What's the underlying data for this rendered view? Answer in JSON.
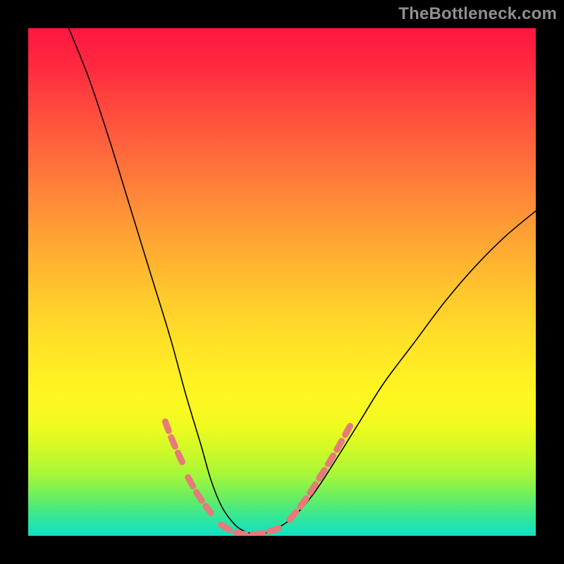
{
  "watermark": "TheBottleneck.com",
  "chart_data": {
    "type": "line",
    "title": "",
    "xlabel": "",
    "ylabel": "",
    "xlim": [
      0,
      100
    ],
    "ylim": [
      0,
      100
    ],
    "grid": false,
    "legend": false,
    "background_gradient": {
      "direction": "vertical",
      "stops": [
        {
          "pos": 0.0,
          "color": "#ff163f"
        },
        {
          "pos": 0.25,
          "color": "#ff6a3c"
        },
        {
          "pos": 0.5,
          "color": "#ffc72d"
        },
        {
          "pos": 0.75,
          "color": "#f2fb1f"
        },
        {
          "pos": 1.0,
          "color": "#11e0c6"
        }
      ]
    },
    "series": [
      {
        "name": "bottleneck-curve",
        "color": "#000000",
        "stroke_width": 1.6,
        "x": [
          8,
          12,
          16,
          20,
          24,
          28,
          31,
          34,
          36,
          38,
          40,
          42,
          45,
          48,
          52,
          56,
          60,
          65,
          70,
          76,
          82,
          88,
          94,
          100
        ],
        "y": [
          100,
          90,
          78,
          65,
          52,
          39,
          28,
          18,
          11,
          6,
          3,
          1.2,
          0.3,
          1.0,
          3.5,
          8,
          14,
          22,
          30,
          38,
          46,
          53,
          59,
          64
        ]
      },
      {
        "name": "highlight-left-upper",
        "color": "#e77a7a",
        "stroke_width": 9,
        "x": [
          27.0,
          28.0,
          29.2,
          30.5
        ],
        "y": [
          22.5,
          19.8,
          17.0,
          14.2
        ]
      },
      {
        "name": "highlight-left-lower",
        "color": "#e77a7a",
        "stroke_width": 9,
        "x": [
          31.5,
          33.0,
          34.5,
          36.0
        ],
        "y": [
          11.5,
          8.8,
          6.5,
          4.5
        ]
      },
      {
        "name": "highlight-bottom",
        "color": "#e77a7a",
        "stroke_width": 9,
        "x": [
          38.0,
          40.0,
          42.0,
          44.0,
          46.0,
          48.0,
          50.0
        ],
        "y": [
          2.2,
          1.0,
          0.4,
          0.3,
          0.5,
          1.0,
          1.8
        ]
      },
      {
        "name": "highlight-right",
        "color": "#e77a7a",
        "stroke_width": 9,
        "x": [
          51.5,
          53.0,
          54.5,
          56.0,
          57.5,
          59.5,
          61.5,
          63.5
        ],
        "y": [
          3.2,
          5.0,
          7.0,
          9.2,
          11.6,
          14.8,
          18.2,
          21.8
        ]
      }
    ]
  }
}
